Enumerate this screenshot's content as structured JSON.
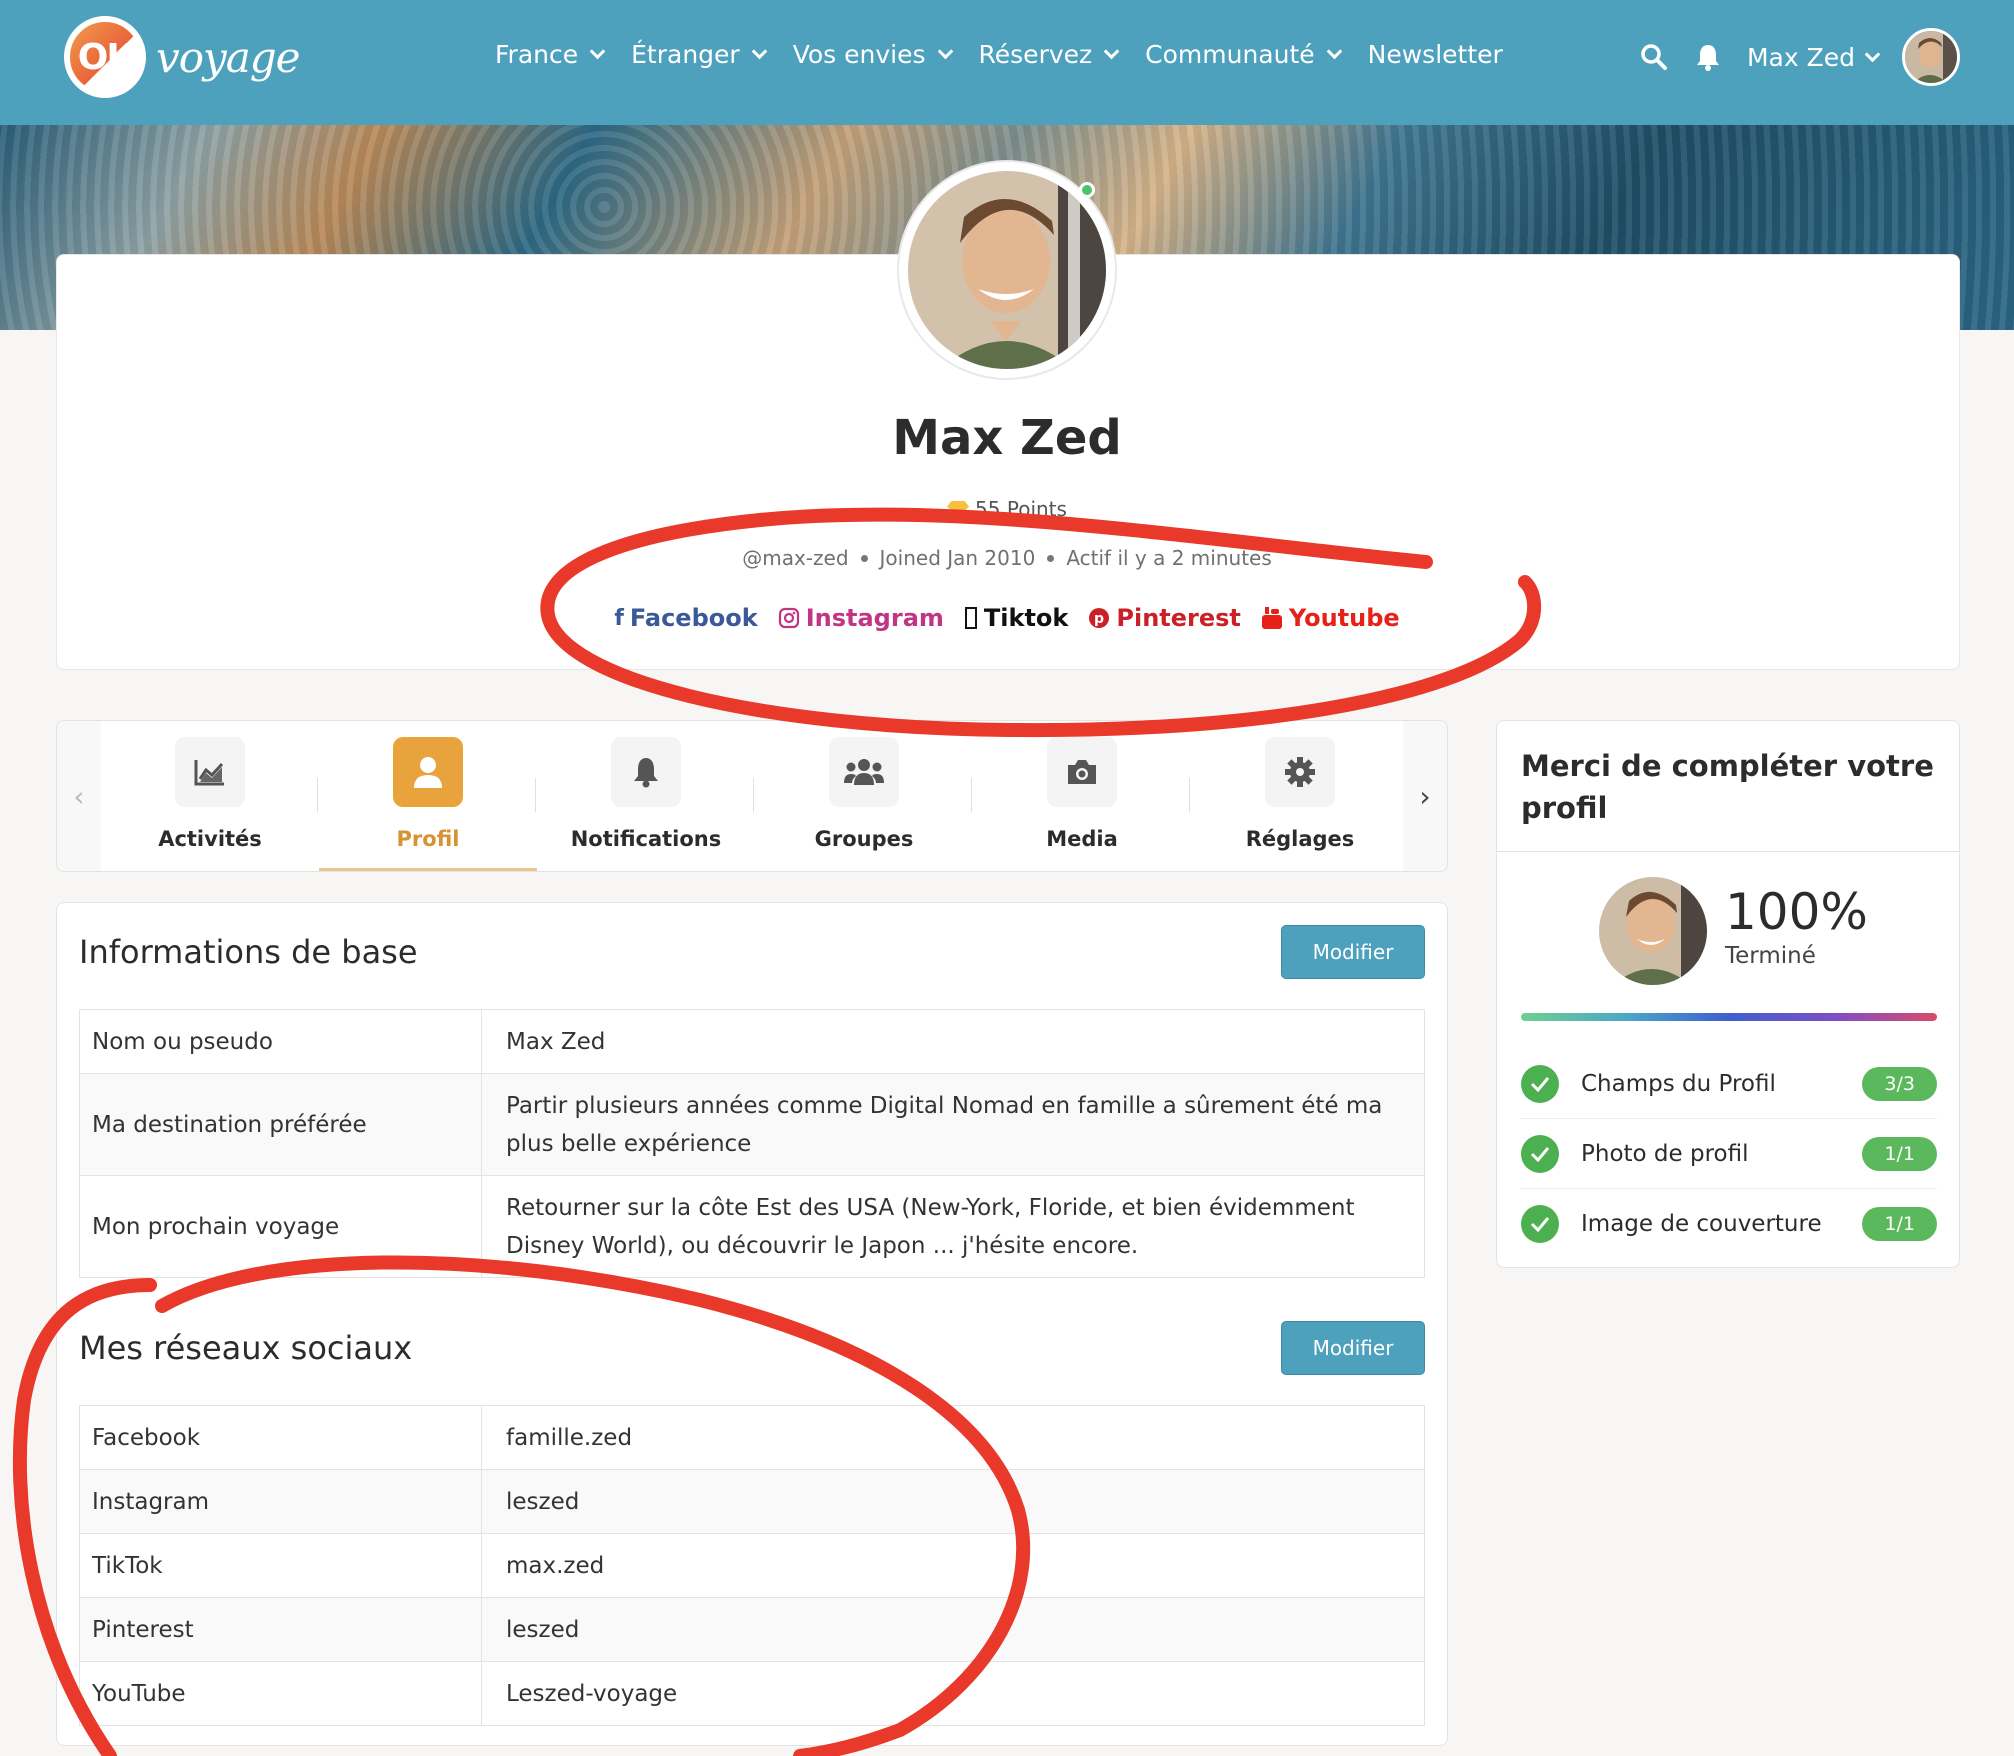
{
  "brand": {
    "logo_ok": "OK",
    "logo_voyage": "voyage"
  },
  "nav": [
    {
      "label": "France",
      "has_dropdown": true
    },
    {
      "label": "Étranger",
      "has_dropdown": true
    },
    {
      "label": "Vos envies",
      "has_dropdown": true
    },
    {
      "label": "Réservez",
      "has_dropdown": true
    },
    {
      "label": "Communauté",
      "has_dropdown": true
    },
    {
      "label": "Newsletter",
      "has_dropdown": false
    }
  ],
  "header": {
    "user_name": "Max Zed",
    "icons": [
      "search-icon",
      "bell-icon",
      "chevron-down-icon"
    ]
  },
  "profile": {
    "name": "Max Zed",
    "points": "55 Points",
    "handle": "@max-zed",
    "joined": "Joined Jan 2010",
    "active": "Actif il y a 2 minutes",
    "online": true,
    "social_links": [
      {
        "label": "Facebook",
        "icon": "facebook-icon",
        "color": "#3b5998"
      },
      {
        "label": "Instagram",
        "icon": "instagram-icon",
        "color": "#c13584"
      },
      {
        "label": "Tiktok",
        "icon": "tiktok-icon",
        "color": "#111111"
      },
      {
        "label": "Pinterest",
        "icon": "pinterest-icon",
        "color": "#cb2027"
      },
      {
        "label": "Youtube",
        "icon": "youtube-icon",
        "color": "#e62117"
      }
    ]
  },
  "tabs": [
    {
      "label": "Activités",
      "icon": "chart-icon",
      "active": false
    },
    {
      "label": "Profil",
      "icon": "user-icon",
      "active": true
    },
    {
      "label": "Notifications",
      "icon": "bell-icon",
      "active": false
    },
    {
      "label": "Groupes",
      "icon": "users-icon",
      "active": false
    },
    {
      "label": "Media",
      "icon": "camera-icon",
      "active": false
    },
    {
      "label": "Réglages",
      "icon": "gear-icon",
      "active": false
    }
  ],
  "basic_info": {
    "title": "Informations de base",
    "button": "Modifier",
    "rows": [
      {
        "key": "Nom ou pseudo",
        "value": "Max Zed"
      },
      {
        "key": "Ma destination préférée",
        "value": "Partir plusieurs années comme Digital Nomad en famille a sûrement été ma plus belle expérience"
      },
      {
        "key": "Mon prochain voyage",
        "value": "Retourner sur la côte Est des USA (New-York, Floride, et bien évidemment Disney World), ou découvrir le Japon ... j'hésite encore."
      }
    ]
  },
  "social_info": {
    "title": "Mes réseaux sociaux",
    "button": "Modifier",
    "rows": [
      {
        "key": "Facebook",
        "value": "famille.zed"
      },
      {
        "key": "Instagram",
        "value": "leszed"
      },
      {
        "key": "TikTok",
        "value": "max.zed"
      },
      {
        "key": "Pinterest",
        "value": "leszed"
      },
      {
        "key": "YouTube",
        "value": "Leszed-voyage"
      }
    ]
  },
  "completion": {
    "title": "Merci de compléter votre profil",
    "percent": "100%",
    "status": "Terminé",
    "progress": 1.0,
    "items": [
      {
        "label": "Champs du Profil",
        "badge": "3/3"
      },
      {
        "label": "Photo de profil",
        "badge": "1/1"
      },
      {
        "label": "Image de couverture",
        "badge": "1/1"
      }
    ]
  },
  "colors": {
    "header": "#4ea1bd",
    "accent": "#e8a33d",
    "annotation": "#e8392a",
    "success": "#5cb85c"
  }
}
